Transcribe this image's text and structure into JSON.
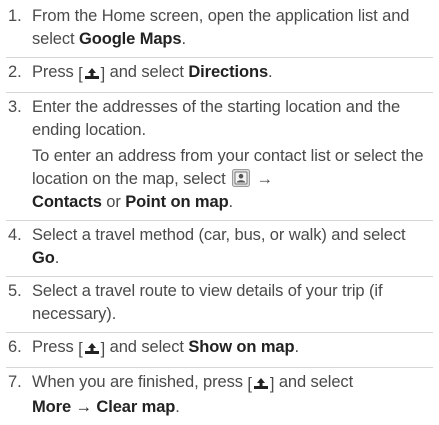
{
  "steps": [
    {
      "number": "1.",
      "t1": "From the Home screen, open the application list and select ",
      "b1": "Google Maps",
      "t2": "."
    },
    {
      "number": "2.",
      "t1": "Press ",
      "key_open": "[",
      "key_close": "]",
      "t2": " and select ",
      "b1": "Directions",
      "t3": "."
    },
    {
      "number": "3.",
      "t1": "Enter the addresses of the starting location and the ending location.",
      "s1": "To enter an address from your contact list or select the location on the map, select ",
      "arrow": " → ",
      "b1": "Contacts",
      "or": " or ",
      "b2": "Point on map",
      "t2": "."
    },
    {
      "number": "4.",
      "t1": "Select a travel method (car, bus, or walk) and select ",
      "b1": "Go",
      "t2": "."
    },
    {
      "number": "5.",
      "t1": "Select a travel route to view details of your trip (if necessary)."
    },
    {
      "number": "6.",
      "t1": "Press ",
      "key_open": "[",
      "key_close": "]",
      "t2": " and select ",
      "b1": "Show on map",
      "t3": "."
    },
    {
      "number": "7.",
      "t1": "When you are finished, press ",
      "key_open": "[",
      "key_close": "]",
      "t2": " and select ",
      "b1": "More → Clear map",
      "t3": "."
    }
  ],
  "icons": {
    "menu_key": "menu-key-icon",
    "contact_button": "contact-select-icon"
  }
}
